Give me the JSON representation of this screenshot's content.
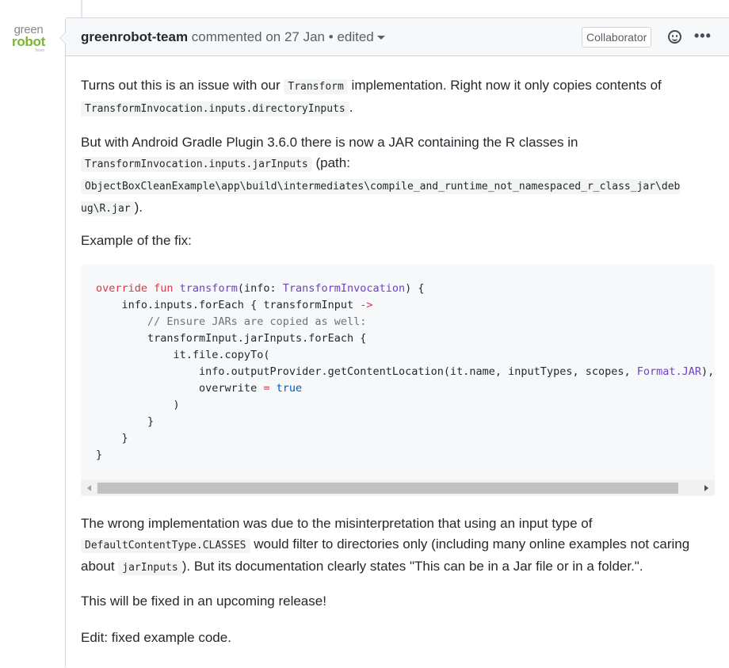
{
  "avatar": {
    "line1": "green",
    "line2": "robot",
    "line3": "Team"
  },
  "comment": {
    "author": "greenrobot-team",
    "action": " commented on 27 Jan",
    "separator": " • ",
    "edited": "edited",
    "badge": "Collaborator"
  },
  "body": {
    "p1_a": "Turns out this is an issue with our ",
    "p1_code1": "Transform",
    "p1_b": " implementation. Right now it only copies contents of ",
    "p1_code2": "TransformInvocation.inputs.directoryInputs",
    "p1_c": ".",
    "p2_a": "But with Android Gradle Plugin 3.6.0 there is now a JAR containing the R classes in ",
    "p2_code1": "TransformInvocation.inputs.jarInputs",
    "p2_b": " (path: ",
    "p2_code2": "ObjectBoxCleanExample\\app\\build\\intermediates\\compile_and_runtime_not_namespaced_r_class_jar\\deb ug\\R.jar",
    "p2_c": ").",
    "p3": "Example of the fix:",
    "p4_a": "The wrong implementation was due to the misinterpretation that using an input type of ",
    "p4_code1": "DefaultContentType.CLASSES",
    "p4_b": " would filter to directories only (including many online examples not caring about ",
    "p4_code2": "jarInputs",
    "p4_c": "). But its documentation clearly states \"This can be in a Jar file or in a folder.\".",
    "p5": "This will be fixed in an upcoming release!",
    "p6": "Edit: fixed example code."
  },
  "code": {
    "l1_kw": "override fun ",
    "l1_fn": "transform",
    "l1_a": "(info: ",
    "l1_type": "TransformInvocation",
    "l1_b": ") {",
    "l2_a": "    info.inputs.forEach { transformInput ",
    "l2_arrow": "->",
    "l3": "        // Ensure JARs are copied as well:",
    "l4": "        transformInput.jarInputs.forEach {",
    "l5": "            it.file.copyTo(",
    "l6_a": "                info.outputProvider.getContentLocation(it.name, inputTypes, scopes, ",
    "l6_type": "Format.JAR",
    "l6_b": "),",
    "l7_a": "                overwrite ",
    "l7_eq": "=",
    "l7_sp": " ",
    "l7_true": "true",
    "l8": "            )",
    "l9": "        }",
    "l10": "    }",
    "l11": "}"
  }
}
